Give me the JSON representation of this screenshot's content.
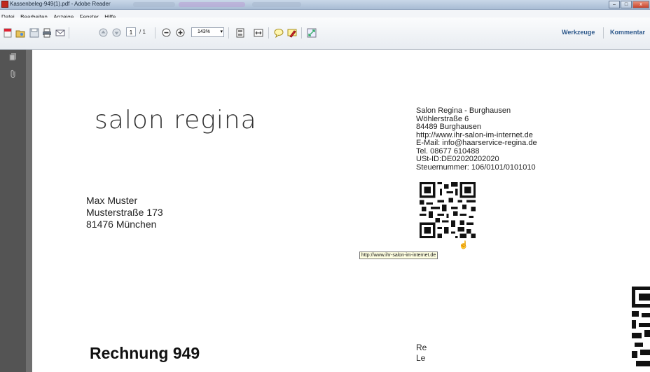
{
  "window": {
    "title": "Kassenbeleg-949(1).pdf - Adobe Reader",
    "controls": {
      "minimize": "–",
      "maximize": "□",
      "close": "x"
    }
  },
  "menu": {
    "items": [
      "Datei",
      "Bearbeiten",
      "Anzeige",
      "Fenster",
      "Hilfe"
    ]
  },
  "toolbar": {
    "page_current": "1",
    "page_total": "/ 1",
    "zoom": "143%",
    "tools_label": "Werkzeuge",
    "comment_label": "Kommentar"
  },
  "document": {
    "logo": "salon regina",
    "company": [
      "Salon Regina - Burghausen",
      "Wöhlerstraße  6",
      "84489 Burghausen",
      "http://www.ihr-salon-im-internet.de",
      "E-Mail: info@haarservice-regina.de",
      "Tel. 08677 610488",
      "USt-ID:DE02020202020",
      "Steuernummer: 106/0101/0101010"
    ],
    "customer": [
      "Max Muster",
      "Musterstraße 173",
      "81476 München"
    ],
    "tooltip": "http://www.ihr-salon-im-internet.de",
    "invoice_title": "Rechnung 949",
    "right_lines": [
      "Re",
      "Le"
    ]
  },
  "colors": {
    "accent_link": "#2f5a8c",
    "app_icon": "#c0281e",
    "close_button": "#c8432b"
  }
}
